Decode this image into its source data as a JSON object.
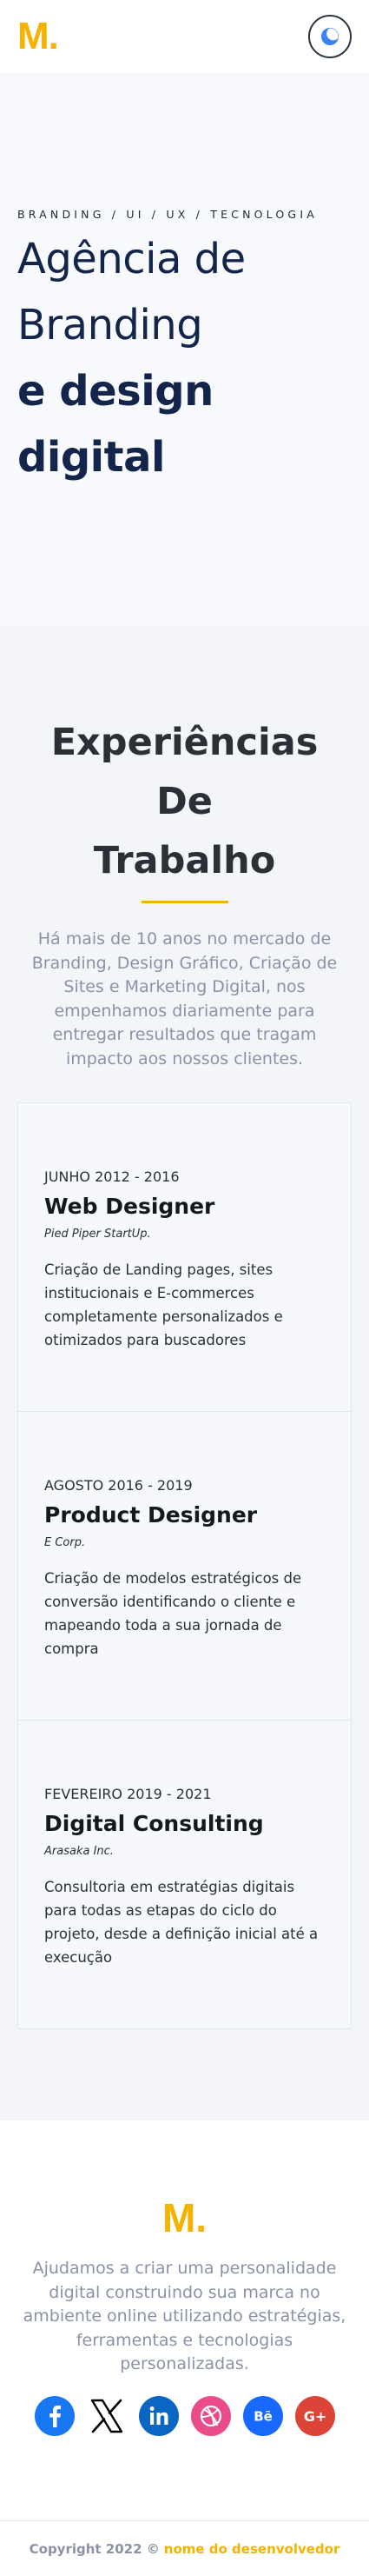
{
  "header": {
    "logo": "M.",
    "theme_toggle_icon": "moon-icon"
  },
  "hero": {
    "kicker": "BRANDING / UI / UX / TECNOLOGIA",
    "line1": "Agência de",
    "line2": "Branding",
    "line3": "e design",
    "line4": "digital"
  },
  "experience": {
    "title_line1": "Experiências De",
    "title_line2": "Trabalho",
    "intro": "Há mais de 10 anos no mercado de Branding, Design Gráfico, Criação de Sites e Marketing Digital, nos empenhamos diariamente para entregar resultados que tragam impacto aos nossos clientes.",
    "items": [
      {
        "date": "JUNHO 2012 - 2016",
        "role": "Web Designer",
        "company": "Pied Piper StartUp.",
        "description": "Criação de Landing pages, sites institucionais e E-commerces completamente personalizados e otimizados para buscadores"
      },
      {
        "date": "AGOSTO 2016 - 2019",
        "role": "Product Designer",
        "company": "E Corp.",
        "description": "Criação de modelos estratégicos de conversão identificando o cliente e mapeando toda a sua jornada de compra"
      },
      {
        "date": "FEVEREIRO 2019 - 2021",
        "role": "Digital Consulting",
        "company": "Arasaka Inc.",
        "description": "Consultoria em estratégias digitais para todas as etapas do ciclo do projeto, desde a definição inicial até a execução"
      }
    ]
  },
  "footer": {
    "logo": "M.",
    "text": "Ajudamos a criar uma personalidade digital construindo sua marca no ambiente online utilizando estratégias, ferramentas e tecnologias personalizadas.",
    "socials": [
      {
        "icon": "facebook-icon",
        "color": "#1877f2"
      },
      {
        "icon": "x-icon",
        "color": "#000000"
      },
      {
        "icon": "linkedin-icon",
        "color": "#0a66c2"
      },
      {
        "icon": "dribbble-icon",
        "color": "#ea4c89"
      },
      {
        "icon": "behance-icon",
        "color": "#1769ff"
      },
      {
        "icon": "google-plus-icon",
        "color": "#db4437"
      }
    ],
    "copyright_prefix": "Copyright 2022 ©",
    "copyright_dev": "nome do desenvolvedor"
  },
  "colors": {
    "accent": "#f5b300",
    "heading": "#13254a",
    "muted": "#8a93a6"
  }
}
